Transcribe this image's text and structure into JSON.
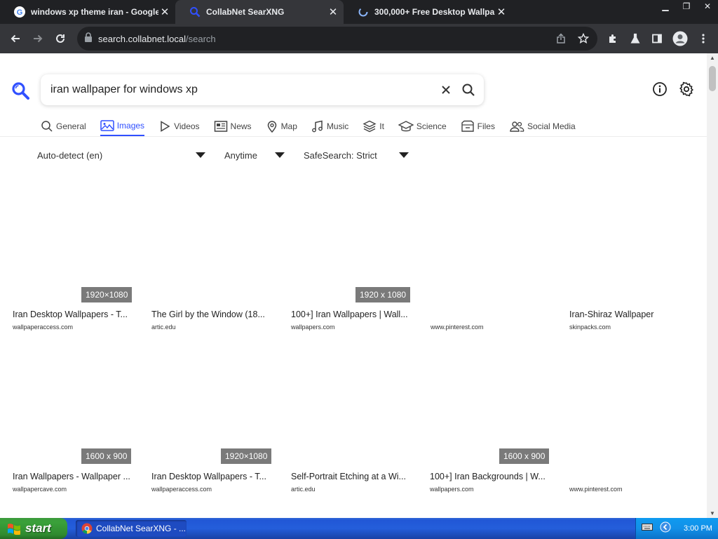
{
  "browser": {
    "tabs": [
      {
        "title": "windows xp theme iran - Google",
        "active": false
      },
      {
        "title": "CollabNet SearXNG",
        "active": true
      },
      {
        "title": "300,000+ Free Desktop Wallpaper",
        "active": false
      }
    ],
    "address": {
      "host": "search.collabnet.local",
      "path": "/search"
    }
  },
  "search": {
    "query": "iran wallpaper for windows xp"
  },
  "categories": [
    {
      "label": "General",
      "icon": "search-icon",
      "active": false
    },
    {
      "label": "Images",
      "icon": "image-icon",
      "active": true
    },
    {
      "label": "Videos",
      "icon": "play-icon",
      "active": false
    },
    {
      "label": "News",
      "icon": "newspaper-icon",
      "active": false
    },
    {
      "label": "Map",
      "icon": "map-pin-icon",
      "active": false
    },
    {
      "label": "Music",
      "icon": "music-note-icon",
      "active": false
    },
    {
      "label": "It",
      "icon": "layers-icon",
      "active": false
    },
    {
      "label": "Science",
      "icon": "graduation-cap-icon",
      "active": false
    },
    {
      "label": "Files",
      "icon": "file-box-icon",
      "active": false
    },
    {
      "label": "Social Media",
      "icon": "people-icon",
      "active": false
    }
  ],
  "filters": {
    "language": "Auto-detect (en)",
    "time": "Anytime",
    "safesearch": "SafeSearch: Strict"
  },
  "results": [
    {
      "badge": "1920×1080",
      "title": "Iran Desktop Wallpapers - T...",
      "url": "wallpaperaccess.com"
    },
    {
      "badge": "",
      "title": "The Girl by the Window (18...",
      "url": "artic.edu"
    },
    {
      "badge": "1920 x 1080",
      "title": "100+] Iran Wallpapers | Wall...",
      "url": "wallpapers.com"
    },
    {
      "badge": "",
      "title": "",
      "url": "www.pinterest.com"
    },
    {
      "badge": "",
      "title": "Iran-Shiraz Wallpaper",
      "url": "skinpacks.com"
    },
    {
      "badge": "1600 x 900",
      "title": "Iran Wallpapers - Wallpaper ...",
      "url": "wallpapercave.com"
    },
    {
      "badge": "1920×1080",
      "title": "Iran Desktop Wallpapers - T...",
      "url": "wallpaperaccess.com"
    },
    {
      "badge": "",
      "title": "Self-Portrait Etching at a Wi...",
      "url": "artic.edu"
    },
    {
      "badge": "1600 x 900",
      "title": "100+] Iran Backgrounds | W...",
      "url": "wallpapers.com"
    },
    {
      "badge": "",
      "title": "",
      "url": "www.pinterest.com"
    }
  ],
  "taskbar": {
    "start_label": "start",
    "task_label": "CollabNet SearXNG - ...",
    "clock": "3:00 PM"
  },
  "colors": {
    "accent": "#3050ff",
    "badge_bg": "#7a7a7a",
    "chrome_dark": "#202124",
    "xp_blue": "#245edb",
    "xp_green": "#3aa13a"
  }
}
